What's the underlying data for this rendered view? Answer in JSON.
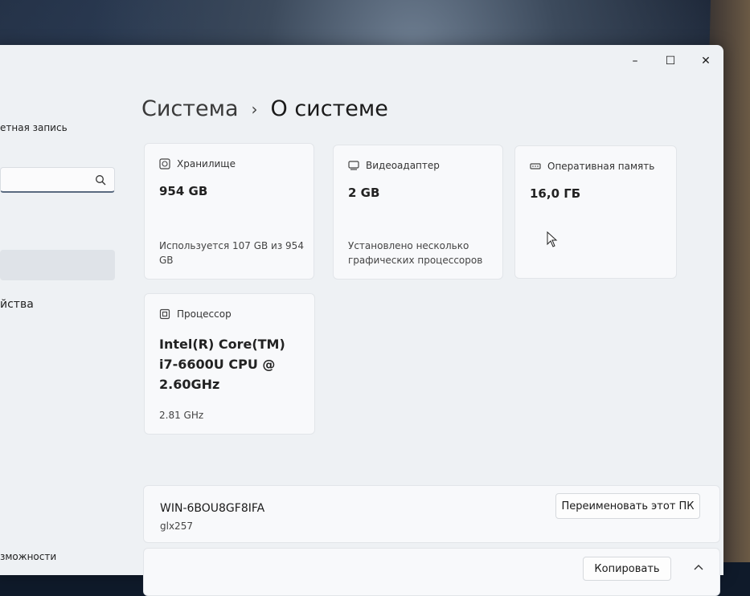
{
  "sidebar": {
    "account_label": "етная запись",
    "search_placeholder": "",
    "item_partial": "йства",
    "item_bottom_partial": "зможности"
  },
  "breadcrumb": {
    "parent": "Система",
    "current": "О системе"
  },
  "storage": {
    "label": "Хранилище",
    "value": "954 GB",
    "usage_line1": "Используется 107 GB из 954",
    "usage_line2": "GB"
  },
  "gpu": {
    "label": "Видеоадаптер",
    "value": "2 GB",
    "note_line1": "Установлено несколько",
    "note_line2": "графических процессоров"
  },
  "ram": {
    "label": "Оперативная память",
    "value": "16,0 ГБ"
  },
  "cpu": {
    "label": "Процессор",
    "name_line1": "Intel(R) Core(TM)",
    "name_line2": "i7-6600U CPU @",
    "name_line3": "2.60GHz",
    "speed": "2.81 GHz"
  },
  "device": {
    "name": "WIN-6BOU8GF8IFA",
    "model": "glx257",
    "rename_label": "Переименовать этот ПК",
    "copy_label": "Копировать"
  },
  "window_controls": {
    "minimize": "–",
    "maximize": "☐",
    "close": "✕"
  }
}
